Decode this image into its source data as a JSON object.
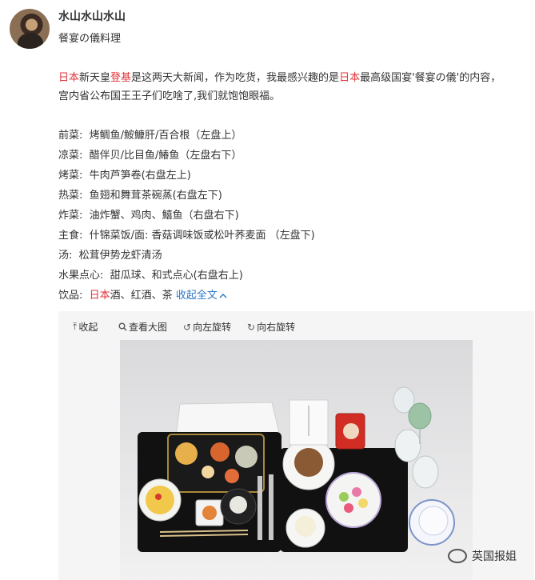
{
  "user": {
    "name": "水山水山水山",
    "subtitle": "餐宴の儀料理"
  },
  "post": {
    "line1_parts": [
      {
        "text": "日本",
        "color": "red"
      },
      {
        "text": "新天皇",
        "color": "normal"
      },
      {
        "text": "登基",
        "color": "red"
      },
      {
        "text": "是这两天大新闻，作为吃货，我最感兴趣的是",
        "color": "normal"
      },
      {
        "text": "日本",
        "color": "red"
      },
      {
        "text": "最高级国宴'餐宴の儀'的内容，",
        "color": "normal"
      }
    ],
    "line2": "宫内省公布国王王子们吃啥了,我们就饱饱眼福。"
  },
  "menu": [
    {
      "label": "前菜:",
      "value": "烤鲷鱼/鮟鱇肝/百合根（左盘上）"
    },
    {
      "label": "凉菜:",
      "value": "醋伴贝/比目鱼/鰆鱼（左盘右下）"
    },
    {
      "label": "烤菜:",
      "value": "牛肉芦笋卷(右盘左上)"
    },
    {
      "label": "热菜:",
      "value": "鱼翅和舞茸茶碗蒸(右盘左下)"
    },
    {
      "label": "炸菜:",
      "value": "油炸蟹、鸡肉、鱚鱼（右盘右下)"
    },
    {
      "label": "主食:",
      "value": "什锦菜饭/面:  香菇调味饭或松叶荞麦面 （左盘下)"
    },
    {
      "label": "汤:",
      "value": "松茸伊势龙虾清汤"
    },
    {
      "label": "水果点心:",
      "value": "甜瓜球、和式点心(右盘右上)"
    }
  ],
  "drinks": {
    "label": "饮品:",
    "red_part": "日本",
    "rest": "酒、红酒、茶",
    "collapse_link": "收起全文"
  },
  "toolbar": {
    "collapse": "收起",
    "view_large": "查看大图",
    "rotate_left": "向左旋转",
    "rotate_right": "向右旋转"
  },
  "watermark": {
    "text": "英国报姐"
  },
  "colors": {
    "red_text": "#e2333a",
    "link_blue": "#2e78c9",
    "toolbar_bg": "#f5f5f5"
  }
}
